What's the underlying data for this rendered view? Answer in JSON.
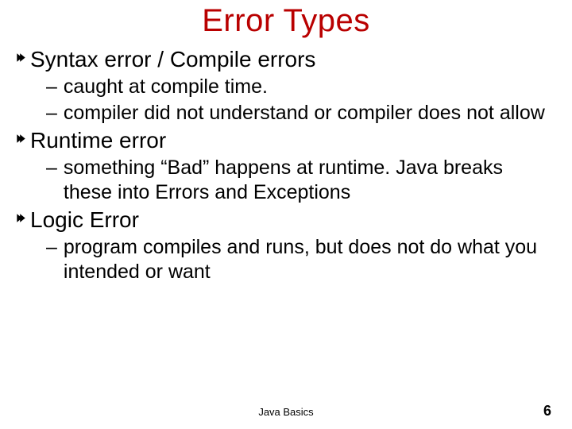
{
  "title": "Error Types",
  "items": [
    {
      "label": "Syntax error / Compile errors",
      "subs": [
        "caught at compile time.",
        "compiler did not understand or compiler does not allow"
      ]
    },
    {
      "label": "Runtime error",
      "subs": [
        "something “Bad” happens at runtime. Java breaks these into Errors and Exceptions"
      ]
    },
    {
      "label": "Logic Error",
      "subs": [
        "program compiles and runs, but does not do what you intended or want"
      ]
    }
  ],
  "footer": "Java Basics",
  "page_number": "6"
}
